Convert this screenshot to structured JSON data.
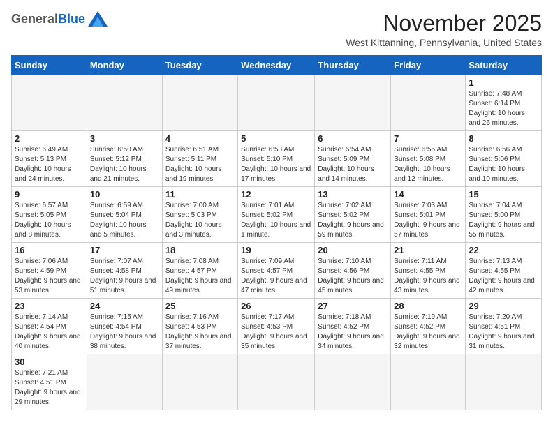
{
  "header": {
    "logo_general": "General",
    "logo_blue": "Blue",
    "month_title": "November 2025",
    "location": "West Kittanning, Pennsylvania, United States"
  },
  "weekdays": [
    "Sunday",
    "Monday",
    "Tuesday",
    "Wednesday",
    "Thursday",
    "Friday",
    "Saturday"
  ],
  "weeks": [
    [
      {
        "day": "",
        "info": ""
      },
      {
        "day": "",
        "info": ""
      },
      {
        "day": "",
        "info": ""
      },
      {
        "day": "",
        "info": ""
      },
      {
        "day": "",
        "info": ""
      },
      {
        "day": "",
        "info": ""
      },
      {
        "day": "1",
        "info": "Sunrise: 7:48 AM\nSunset: 6:14 PM\nDaylight: 10 hours\nand 26 minutes."
      }
    ],
    [
      {
        "day": "2",
        "info": "Sunrise: 6:49 AM\nSunset: 5:13 PM\nDaylight: 10 hours\nand 24 minutes."
      },
      {
        "day": "3",
        "info": "Sunrise: 6:50 AM\nSunset: 5:12 PM\nDaylight: 10 hours\nand 21 minutes."
      },
      {
        "day": "4",
        "info": "Sunrise: 6:51 AM\nSunset: 5:11 PM\nDaylight: 10 hours\nand 19 minutes."
      },
      {
        "day": "5",
        "info": "Sunrise: 6:53 AM\nSunset: 5:10 PM\nDaylight: 10 hours\nand 17 minutes."
      },
      {
        "day": "6",
        "info": "Sunrise: 6:54 AM\nSunset: 5:09 PM\nDaylight: 10 hours\nand 14 minutes."
      },
      {
        "day": "7",
        "info": "Sunrise: 6:55 AM\nSunset: 5:08 PM\nDaylight: 10 hours\nand 12 minutes."
      },
      {
        "day": "8",
        "info": "Sunrise: 6:56 AM\nSunset: 5:06 PM\nDaylight: 10 hours\nand 10 minutes."
      }
    ],
    [
      {
        "day": "9",
        "info": "Sunrise: 6:57 AM\nSunset: 5:05 PM\nDaylight: 10 hours\nand 8 minutes."
      },
      {
        "day": "10",
        "info": "Sunrise: 6:59 AM\nSunset: 5:04 PM\nDaylight: 10 hours\nand 5 minutes."
      },
      {
        "day": "11",
        "info": "Sunrise: 7:00 AM\nSunset: 5:03 PM\nDaylight: 10 hours\nand 3 minutes."
      },
      {
        "day": "12",
        "info": "Sunrise: 7:01 AM\nSunset: 5:02 PM\nDaylight: 10 hours\nand 1 minute."
      },
      {
        "day": "13",
        "info": "Sunrise: 7:02 AM\nSunset: 5:02 PM\nDaylight: 9 hours\nand 59 minutes."
      },
      {
        "day": "14",
        "info": "Sunrise: 7:03 AM\nSunset: 5:01 PM\nDaylight: 9 hours\nand 57 minutes."
      },
      {
        "day": "15",
        "info": "Sunrise: 7:04 AM\nSunset: 5:00 PM\nDaylight: 9 hours\nand 55 minutes."
      }
    ],
    [
      {
        "day": "16",
        "info": "Sunrise: 7:06 AM\nSunset: 4:59 PM\nDaylight: 9 hours\nand 53 minutes."
      },
      {
        "day": "17",
        "info": "Sunrise: 7:07 AM\nSunset: 4:58 PM\nDaylight: 9 hours\nand 51 minutes."
      },
      {
        "day": "18",
        "info": "Sunrise: 7:08 AM\nSunset: 4:57 PM\nDaylight: 9 hours\nand 49 minutes."
      },
      {
        "day": "19",
        "info": "Sunrise: 7:09 AM\nSunset: 4:57 PM\nDaylight: 9 hours\nand 47 minutes."
      },
      {
        "day": "20",
        "info": "Sunrise: 7:10 AM\nSunset: 4:56 PM\nDaylight: 9 hours\nand 45 minutes."
      },
      {
        "day": "21",
        "info": "Sunrise: 7:11 AM\nSunset: 4:55 PM\nDaylight: 9 hours\nand 43 minutes."
      },
      {
        "day": "22",
        "info": "Sunrise: 7:13 AM\nSunset: 4:55 PM\nDaylight: 9 hours\nand 42 minutes."
      }
    ],
    [
      {
        "day": "23",
        "info": "Sunrise: 7:14 AM\nSunset: 4:54 PM\nDaylight: 9 hours\nand 40 minutes."
      },
      {
        "day": "24",
        "info": "Sunrise: 7:15 AM\nSunset: 4:54 PM\nDaylight: 9 hours\nand 38 minutes."
      },
      {
        "day": "25",
        "info": "Sunrise: 7:16 AM\nSunset: 4:53 PM\nDaylight: 9 hours\nand 37 minutes."
      },
      {
        "day": "26",
        "info": "Sunrise: 7:17 AM\nSunset: 4:53 PM\nDaylight: 9 hours\nand 35 minutes."
      },
      {
        "day": "27",
        "info": "Sunrise: 7:18 AM\nSunset: 4:52 PM\nDaylight: 9 hours\nand 34 minutes."
      },
      {
        "day": "28",
        "info": "Sunrise: 7:19 AM\nSunset: 4:52 PM\nDaylight: 9 hours\nand 32 minutes."
      },
      {
        "day": "29",
        "info": "Sunrise: 7:20 AM\nSunset: 4:51 PM\nDaylight: 9 hours\nand 31 minutes."
      }
    ],
    [
      {
        "day": "30",
        "info": "Sunrise: 7:21 AM\nSunset: 4:51 PM\nDaylight: 9 hours\nand 29 minutes."
      },
      {
        "day": "",
        "info": ""
      },
      {
        "day": "",
        "info": ""
      },
      {
        "day": "",
        "info": ""
      },
      {
        "day": "",
        "info": ""
      },
      {
        "day": "",
        "info": ""
      },
      {
        "day": "",
        "info": ""
      }
    ]
  ]
}
